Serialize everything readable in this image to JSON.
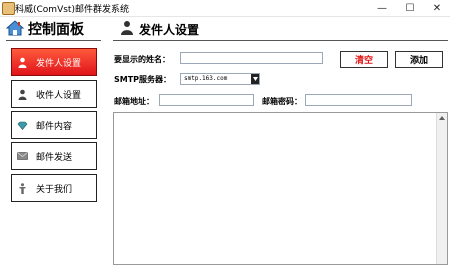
{
  "window": {
    "title": "科威(ComVst)邮件群发系统",
    "minimize_glyph": "—",
    "maximize_glyph": "☐",
    "close_glyph": "✕"
  },
  "sidebar": {
    "title": "控制面板",
    "icon": "home-icon",
    "items": [
      {
        "label": "发件人设置",
        "icon": "sender-icon",
        "active": true
      },
      {
        "label": "收件人设置",
        "icon": "recipient-icon",
        "active": false
      },
      {
        "label": "邮件内容",
        "icon": "content-icon",
        "active": false
      },
      {
        "label": "邮件发送",
        "icon": "mail-send-icon",
        "active": false
      },
      {
        "label": "关于我们",
        "icon": "about-icon",
        "active": false
      }
    ]
  },
  "main": {
    "title": "发件人设置",
    "icon": "user-icon",
    "display_name_label": "要显示的姓名：",
    "display_name_value": "",
    "smtp_label": "SMTP服务器：",
    "smtp_value": "smtp.163.com",
    "email_label": "邮箱地址：",
    "email_value": "",
    "password_label": "邮箱密码：",
    "password_value": "",
    "clear_button": "清空",
    "add_button": "添加"
  },
  "colors": {
    "active_nav": "#e0141b",
    "clear_text": "#e01818"
  }
}
